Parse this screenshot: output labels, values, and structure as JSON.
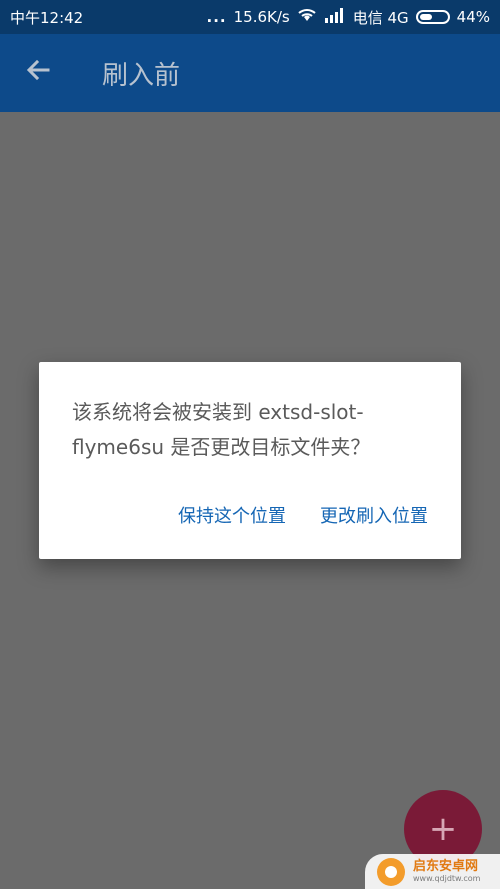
{
  "status": {
    "time": "中午12:42",
    "network_speed": "15.6K/s",
    "carrier": "电信 4G",
    "battery": "44%"
  },
  "app_bar": {
    "title": "刷入前"
  },
  "dialog": {
    "message": "该系统将会被安装到 extsd-slot-flyme6su 是否更改目标文件夹？",
    "keep_button": "保持这个位置",
    "change_button": "更改刷入位置"
  },
  "fab": {
    "label": "+"
  },
  "watermark": {
    "name": "启东安卓网",
    "url": "www.qdjdtw.com"
  }
}
